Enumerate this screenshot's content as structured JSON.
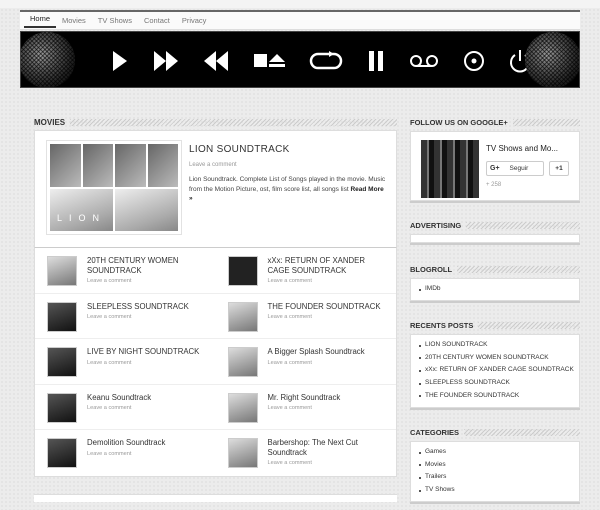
{
  "nav": {
    "items": [
      {
        "label": "Home",
        "active": true
      },
      {
        "label": "Movies"
      },
      {
        "label": "TV Shows"
      },
      {
        "label": "Contact"
      },
      {
        "label": "Privacy"
      }
    ]
  },
  "banner": {
    "controls": [
      "play-icon",
      "fast-forward-icon",
      "rewind-icon",
      "stop-eject-icon",
      "repeat-icon",
      "pause-icon",
      "voicemail-icon",
      "record-icon",
      "power-icon"
    ]
  },
  "main": {
    "section_title": "MOVIES",
    "featured": {
      "title": "LION SOUNDTRACK",
      "comment": "Leave a comment",
      "excerpt": "Lion Soundtrack. Complete List of Songs played in the movie. Music from the Motion Picture, ost, film score list, all songs list",
      "read_more": "Read More »",
      "thumb_text": "LION"
    },
    "posts": [
      {
        "title": "20TH CENTURY WOMEN SOUNDTRACK",
        "comment": "Leave a comment"
      },
      {
        "title": "xXx: RETURN OF XANDER CAGE SOUNDTRACK",
        "comment": "Leave a comment"
      },
      {
        "title": "SLEEPLESS SOUNDTRACK",
        "comment": "Leave a comment"
      },
      {
        "title": "THE FOUNDER SOUNDTRACK",
        "comment": "Leave a comment"
      },
      {
        "title": "LIVE BY NIGHT SOUNDTRACK",
        "comment": "Leave a comment"
      },
      {
        "title": "A Bigger Splash Soundtrack",
        "comment": "Leave a comment"
      },
      {
        "title": "Keanu Soundtrack",
        "comment": "Leave a comment"
      },
      {
        "title": "Mr. Right Soundtrack",
        "comment": "Leave a comment"
      },
      {
        "title": "Demolition Soundtrack",
        "comment": "Leave a comment"
      },
      {
        "title": "Barbershop: The Next Cut Soundtrack",
        "comment": "Leave a comment"
      }
    ]
  },
  "sidebar": {
    "follow": {
      "heading": "FOLLOW US ON GOOGLE+",
      "page_name": "TV Shows and Mo...",
      "g_label": "G+",
      "follow_label": "Seguir",
      "plus_one": "+1",
      "count": "+ 258"
    },
    "advertising": {
      "heading": "ADVERTISING"
    },
    "blogroll": {
      "heading": "BLOGROLL",
      "items": [
        "IMDb"
      ]
    },
    "recent": {
      "heading": "RECENTS POSTS",
      "items": [
        "LION SOUNDTRACK",
        "20TH CENTURY WOMEN SOUNDTRACK",
        "xXx: RETURN OF XANDER CAGE SOUNDTRACK",
        "SLEEPLESS SOUNDTRACK",
        "THE FOUNDER SOUNDTRACK"
      ]
    },
    "categories": {
      "heading": "CATEGORIES",
      "items": [
        "Games",
        "Movies",
        "Trailers",
        "TV Shows"
      ]
    }
  }
}
